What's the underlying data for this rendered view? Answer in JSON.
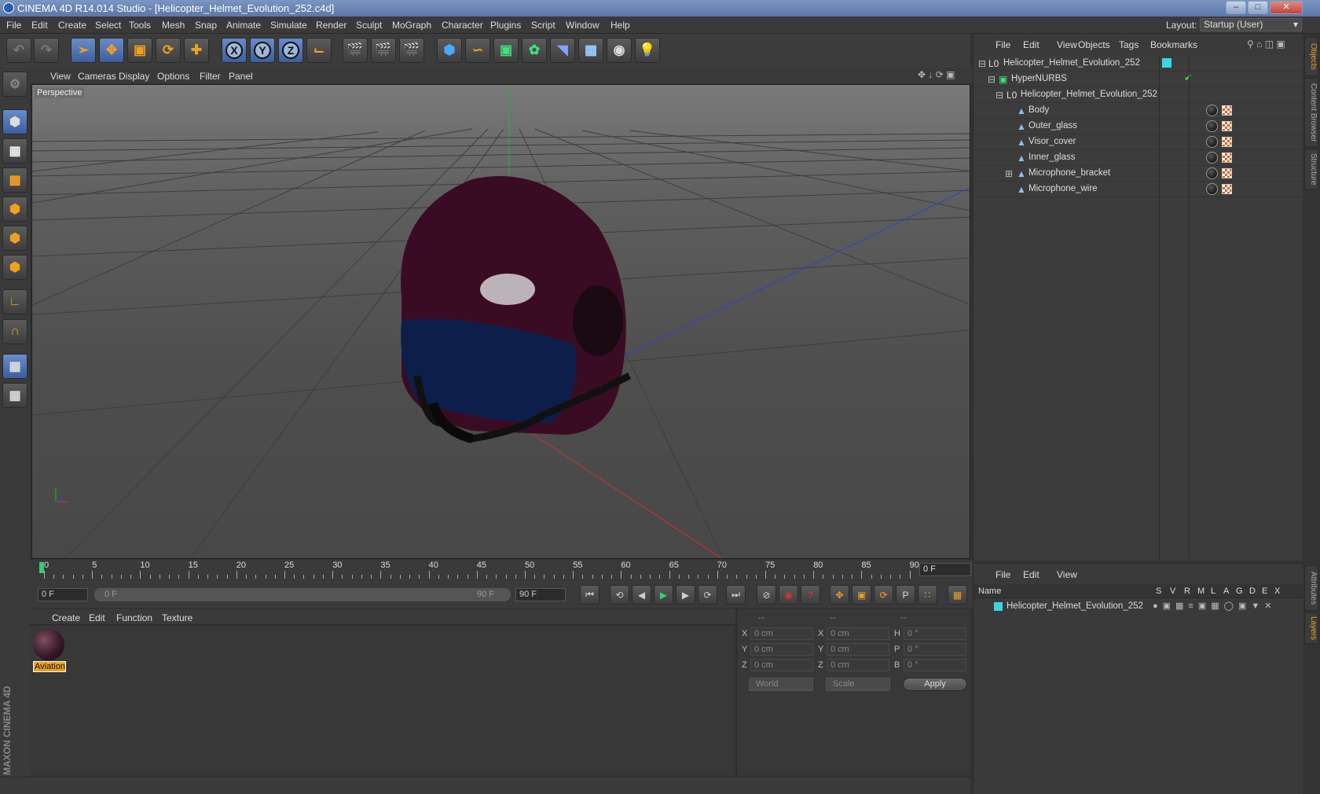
{
  "window": {
    "title": "CINEMA 4D R14.014 Studio - [Helicopter_Helmet_Evolution_252.c4d]",
    "minimize": "–",
    "maximize": "□",
    "close": "✕"
  },
  "menu": [
    "File",
    "Edit",
    "Create",
    "Select",
    "Tools",
    "Mesh",
    "Snap",
    "Animate",
    "Simulate",
    "Render",
    "Sculpt",
    "MoGraph",
    "Character",
    "Plugins",
    "Script",
    "Window",
    "Help"
  ],
  "layout": {
    "label": "Layout:",
    "value": "Startup (User)"
  },
  "viewport": {
    "menu": [
      "View",
      "Cameras",
      "Display",
      "Options",
      "Filter",
      "Panel"
    ],
    "label": "Perspective"
  },
  "timeline": {
    "ticks": [
      "0",
      "5",
      "10",
      "15",
      "20",
      "25",
      "30",
      "35",
      "40",
      "45",
      "50",
      "55",
      "60",
      "65",
      "70",
      "75",
      "80",
      "85",
      "90"
    ],
    "current_frame": "0 F"
  },
  "transport": {
    "start": "0 F",
    "range_start": "0 F",
    "range_end": "90 F",
    "end": "90 F"
  },
  "materials": {
    "menu": [
      "Create",
      "Edit",
      "Function",
      "Texture"
    ],
    "items": [
      {
        "name": "Aviation"
      }
    ]
  },
  "coords": {
    "header": [
      "--",
      "--",
      "--"
    ],
    "rows": [
      {
        "a": "X",
        "av": "0 cm",
        "b": "X",
        "bv": "0 cm",
        "c": "H",
        "cv": "0 °"
      },
      {
        "a": "Y",
        "av": "0 cm",
        "b": "Y",
        "bv": "0 cm",
        "c": "P",
        "cv": "0 °"
      },
      {
        "a": "Z",
        "av": "0 cm",
        "b": "Z",
        "bv": "0 cm",
        "c": "B",
        "cv": "0 °"
      }
    ],
    "mode": "World",
    "type": "Scale",
    "apply": "Apply"
  },
  "objects": {
    "menu": [
      "File",
      "Edit",
      "View",
      "Objects",
      "Tags",
      "Bookmarks"
    ],
    "tree": [
      {
        "name": "Helicopter_Helmet_Evolution_252",
        "icon": "null-icon"
      },
      {
        "name": "HyperNURBS",
        "icon": "hypernurbs-icon"
      },
      {
        "name": "Helicopter_Helmet_Evolution_252",
        "icon": "null-icon"
      },
      {
        "name": "Body",
        "icon": "polygon-icon"
      },
      {
        "name": "Outer_glass",
        "icon": "polygon-icon"
      },
      {
        "name": "Visor_cover",
        "icon": "polygon-icon"
      },
      {
        "name": "Inner_glass",
        "icon": "polygon-icon"
      },
      {
        "name": "Microphone_bracket",
        "icon": "polygon-icon"
      },
      {
        "name": "Microphone_wire",
        "icon": "polygon-icon"
      }
    ]
  },
  "layers": {
    "menu": [
      "File",
      "Edit",
      "View"
    ],
    "columns": [
      "Name",
      "S",
      "V",
      "R",
      "M",
      "L",
      "A",
      "G",
      "D",
      "E",
      "X"
    ],
    "rows": [
      {
        "name": "Helicopter_Helmet_Evolution_252"
      }
    ]
  },
  "right_tabs": [
    "Objects",
    "Content Browser",
    "Structure",
    "Attributes",
    "Layers"
  ],
  "brand": "MAXON CINEMA 4D",
  "colors": {
    "accent": "#f0a020",
    "layer": "#3ad6e0",
    "x_axis": "#d03030",
    "y_axis": "#30b030",
    "z_axis": "#3040d0"
  }
}
